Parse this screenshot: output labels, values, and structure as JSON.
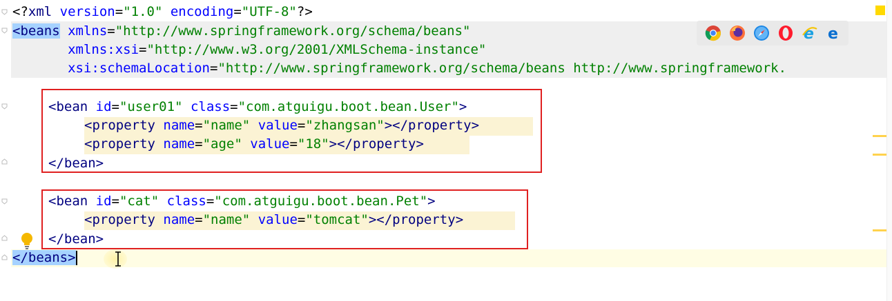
{
  "editor": {
    "line1": {
      "open": "<?",
      "xml": "xml",
      "version_attr": " version",
      "eq1": "=",
      "version_val": "\"1.0\"",
      "encoding_attr": " encoding",
      "eq2": "=",
      "encoding_val": "\"UTF-8\"",
      "close": "?>"
    },
    "line2": {
      "tag": "<beans",
      "attr": " xmlns",
      "eq": "=",
      "val": "\"http://www.springframework.org/schema/beans\""
    },
    "line3": {
      "indent": "       ",
      "attr": "xmlns:xsi",
      "eq": "=",
      "val": "\"http://www.w3.org/2001/XMLSchema-instance\""
    },
    "line4": {
      "indent": "       ",
      "attr": "xsi:schemaLocation",
      "eq": "=",
      "val": "\"http://www.springframework.org/schema/beans http://www.springframework."
    },
    "bean1": {
      "open": "<bean",
      "id_attr": " id",
      "eq1": "=",
      "id_val": "\"user01\"",
      "class_attr": " class",
      "eq2": "=",
      "class_val": "\"com.atguigu.boot.bean.User\"",
      "gt": ">",
      "prop1": {
        "open": "<property",
        "name_attr": " name",
        "eq1": "=",
        "name_val": "\"name\"",
        "value_attr": " value",
        "eq2": "=",
        "value_val": "\"zhangsan\"",
        "close": "></property>"
      },
      "prop2": {
        "open": "<property",
        "name_attr": " name",
        "eq1": "=",
        "name_val": "\"age\"",
        "value_attr": " value",
        "eq2": "=",
        "value_val": "\"18\"",
        "close": "></property>"
      },
      "end": "</bean>"
    },
    "bean2": {
      "open": "<bean",
      "id_attr": " id",
      "eq1": "=",
      "id_val": "\"cat\"",
      "class_attr": " class",
      "eq2": "=",
      "class_val": "\"com.atguigu.boot.bean.Pet\"",
      "gt": ">",
      "prop1": {
        "open": "<property",
        "name_attr": " name",
        "eq1": "=",
        "name_val": "\"name\"",
        "value_attr": " value",
        "eq2": "=",
        "value_val": "\"tomcat\"",
        "close": "></property>"
      },
      "end": "</bean>"
    },
    "closing": "</beans>"
  },
  "browser_icons": [
    "chrome-icon",
    "firefox-icon",
    "safari-icon",
    "opera-icon",
    "ie-icon",
    "edge-icon"
  ],
  "colors": {
    "tag": "#000080",
    "attribute": "#0000ff",
    "value": "#008000",
    "highlight_box": "#e02020",
    "selection": "#a6d2ff"
  }
}
